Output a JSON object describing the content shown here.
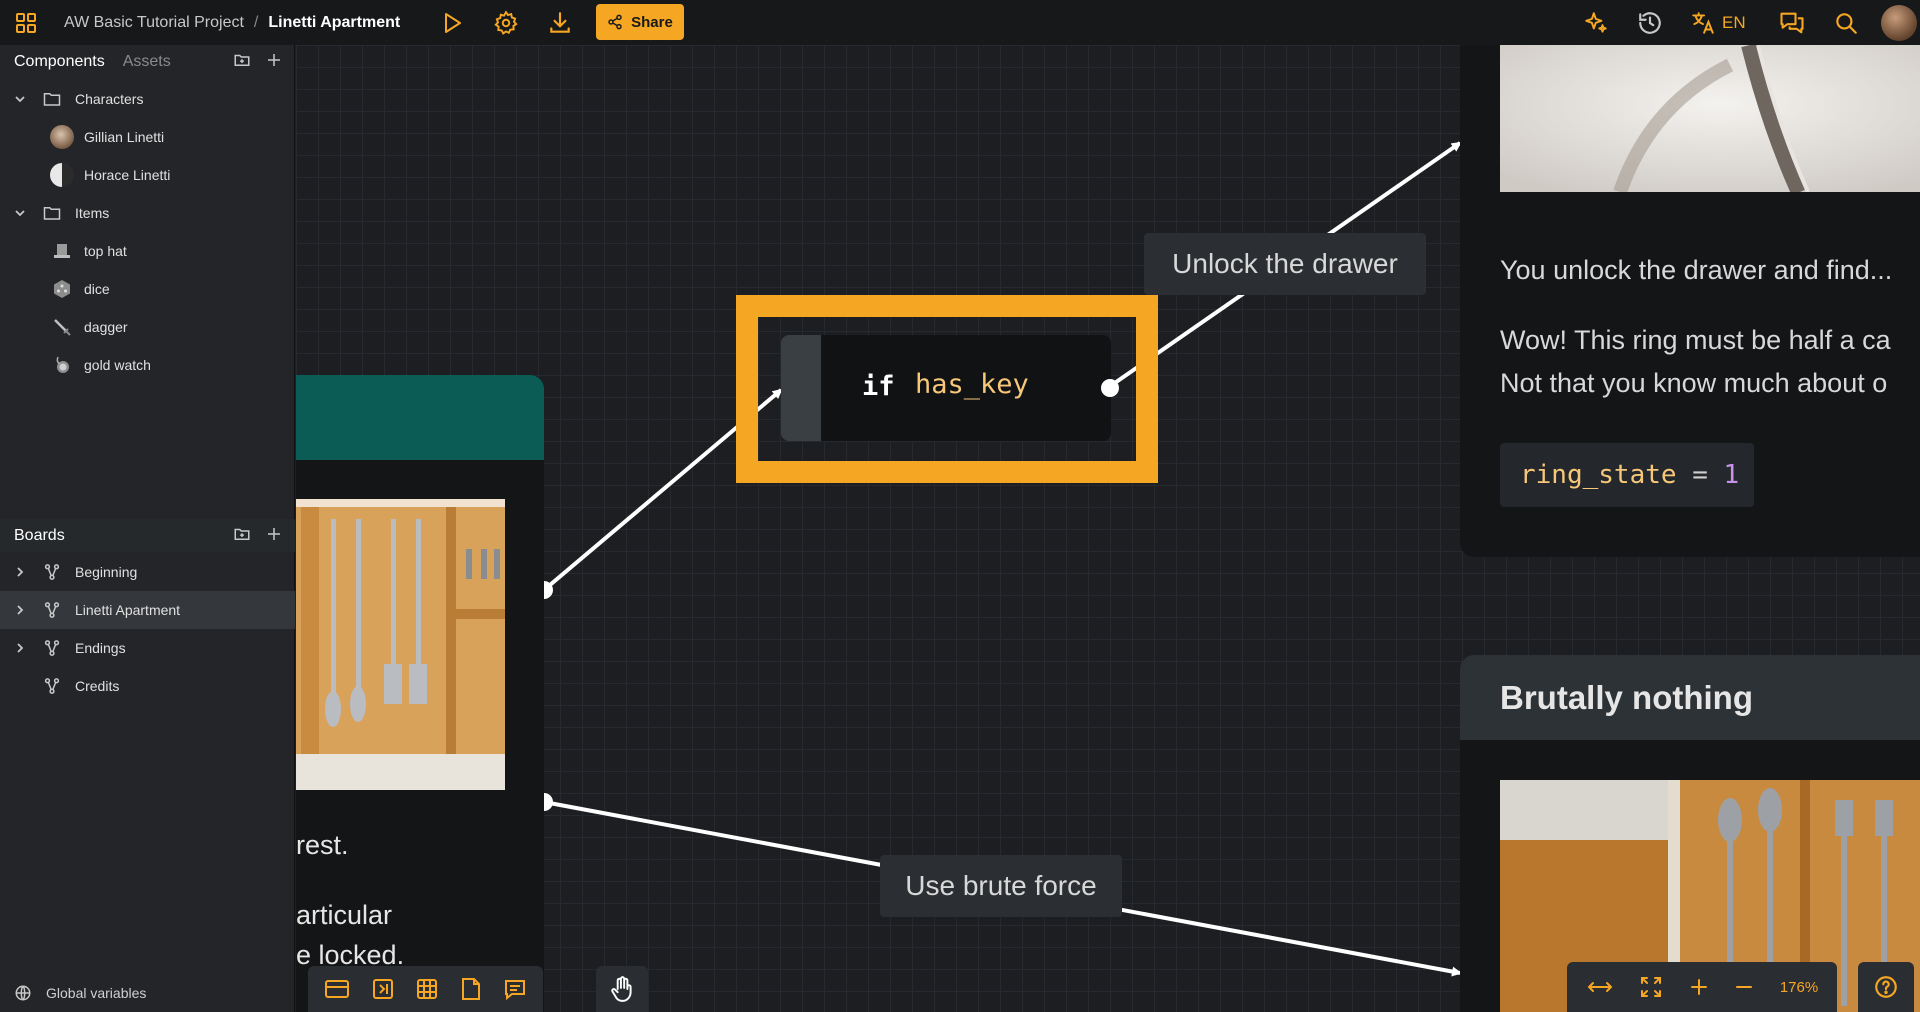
{
  "header": {
    "project": "AW Basic Tutorial Project",
    "separator": "/",
    "current_board": "Linetti Apartment",
    "share_label": "Share",
    "language": "EN"
  },
  "components_panel": {
    "tab_components": "Components",
    "tab_assets": "Assets",
    "folders": [
      {
        "label": "Characters",
        "children": [
          "Gillian Linetti",
          "Horace Linetti"
        ]
      },
      {
        "label": "Items",
        "children": [
          "top hat",
          "dice",
          "dagger",
          "gold watch"
        ]
      }
    ]
  },
  "boards_panel": {
    "title": "Boards",
    "items": [
      "Beginning",
      "Linetti Apartment",
      "Endings",
      "Credits"
    ],
    "selected": "Linetti Apartment"
  },
  "global_variables_label": "Global variables",
  "canvas": {
    "left_card": {
      "text_line1": "rest.",
      "text_line2": "articular",
      "text_line3": "e locked."
    },
    "condition": {
      "keyword": "if",
      "variable": "has_key"
    },
    "connector_labels": {
      "unlock": "Unlock the drawer",
      "brute": "Use brute force"
    },
    "right_card": {
      "line1": "You unlock the drawer and find...",
      "line2": "Wow! This ring must be half a ca",
      "line3": "Not that you know much about o",
      "code_var": "ring_state",
      "code_op": " = ",
      "code_val": "1"
    },
    "brute_card": {
      "title": "Brutally nothing"
    }
  },
  "zoom": {
    "level": "176%"
  },
  "colors": {
    "accent": "#f5a623",
    "canvas_bg": "#1c1e21",
    "teal_header": "#0b5c55",
    "code_var": "#f7c77a",
    "code_num": "#c792ea"
  }
}
